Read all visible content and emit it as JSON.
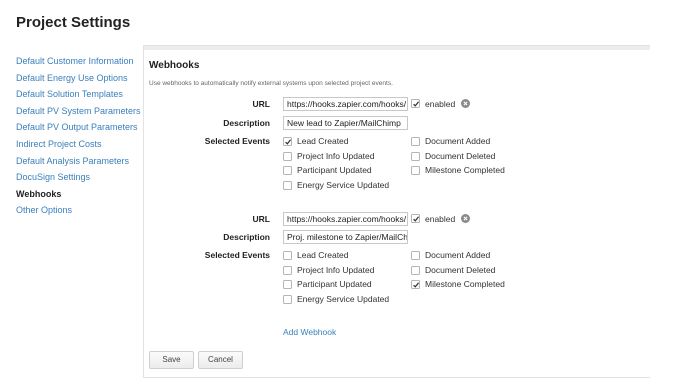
{
  "page": {
    "title": "Project Settings"
  },
  "sidebar": {
    "items": [
      {
        "label": "Default Customer Information"
      },
      {
        "label": "Default Energy Use Options"
      },
      {
        "label": "Default Solution Templates"
      },
      {
        "label": "Default PV System Parameters"
      },
      {
        "label": "Default PV Output Parameters"
      },
      {
        "label": "Indirect Project Costs"
      },
      {
        "label": "Default Analysis Parameters"
      },
      {
        "label": "DocuSign Settings"
      },
      {
        "label": "Webhooks",
        "active": true
      },
      {
        "label": "Other Options"
      }
    ]
  },
  "webhooks": {
    "title": "Webhooks",
    "description": "Use webhooks to automatically notify external systems upon selected project events.",
    "labels": {
      "url": "URL",
      "description": "Description",
      "events": "Selected Events",
      "enabled": "enabled"
    },
    "items": [
      {
        "url": "https://hooks.zapier.com/hooks/",
        "description": "New lead to Zapier/MailChimp",
        "enabled": true,
        "events": [
          {
            "label": "Lead Created",
            "checked": true
          },
          {
            "label": "Project Info Updated",
            "checked": false
          },
          {
            "label": "Participant Updated",
            "checked": false
          },
          {
            "label": "Energy Service Updated",
            "checked": false
          },
          {
            "label": "Document Added",
            "checked": false
          },
          {
            "label": "Document Deleted",
            "checked": false
          },
          {
            "label": "Milestone Completed",
            "checked": false
          }
        ]
      },
      {
        "url": "https://hooks.zapier.com/hooks/",
        "description": "Proj. milestone to Zapier/MailCh",
        "enabled": true,
        "events": [
          {
            "label": "Lead Created",
            "checked": false
          },
          {
            "label": "Project Info Updated",
            "checked": false
          },
          {
            "label": "Participant Updated",
            "checked": false
          },
          {
            "label": "Energy Service Updated",
            "checked": false
          },
          {
            "label": "Document Added",
            "checked": false
          },
          {
            "label": "Document Deleted",
            "checked": false
          },
          {
            "label": "Milestone Completed",
            "checked": true
          }
        ]
      }
    ],
    "add_label": "Add Webhook"
  },
  "buttons": {
    "save": "Save",
    "cancel": "Cancel"
  },
  "colors": {
    "link": "#3a7fbd",
    "check": "#333333",
    "remove_icon": "#8a8a8a"
  },
  "icons": {
    "checkmark": "check-icon",
    "remove": "close-circle-icon"
  }
}
